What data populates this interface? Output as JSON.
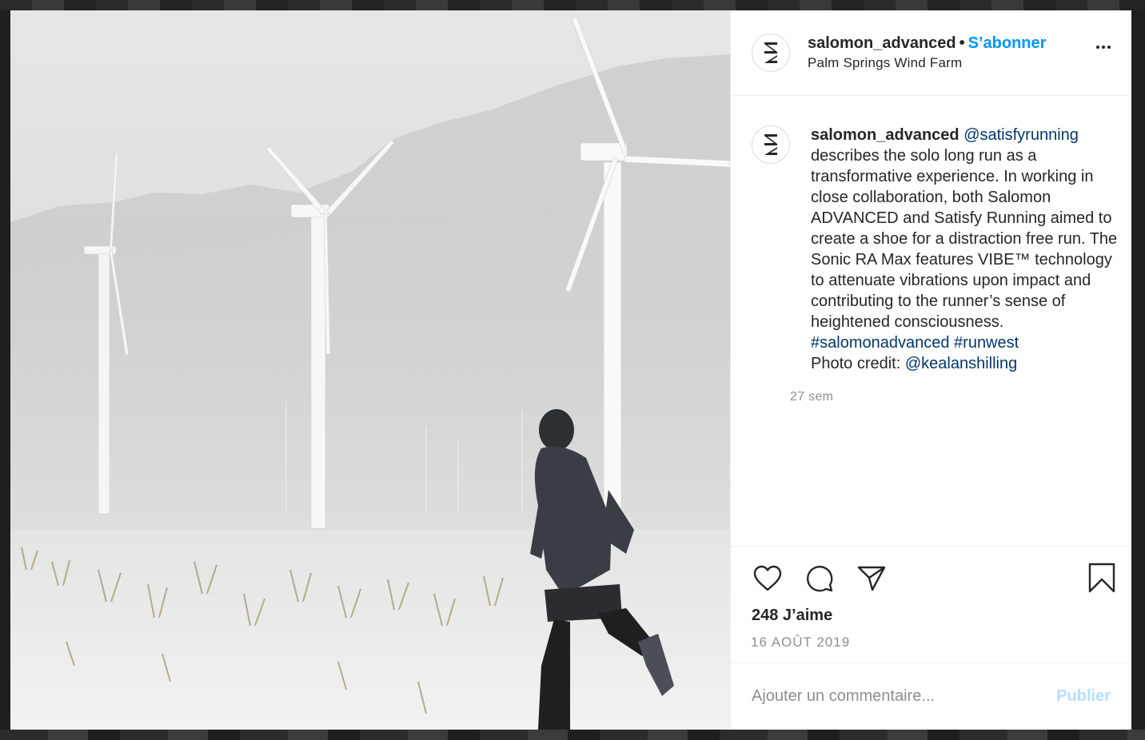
{
  "post": {
    "username": "salomon_advanced",
    "follow_label": "S’abonner",
    "location": "Palm Springs Wind Farm",
    "caption": {
      "username": "salomon_advanced",
      "mention_1": "@satisfyrunning",
      "text_1": "describes the solo long run as a transformative experience. In working in close collaboration, both Salomon ADVANCED and Satisfy Running aimed to create a shoe for a distraction free run. The Sonic RA Max features VIBE™ technology to attenuate vibrations upon impact and contributing to the runner’s sense of heightened consciousness.",
      "hashtag_1": "#salomonadvanced",
      "hashtag_2": "#runwest",
      "credit_label": "Photo credit:",
      "credit_mention": "@kealanshilling"
    },
    "time_ago": "27 sem",
    "likes": "248 J’aime",
    "date": "16 AOÛT 2019",
    "comment_placeholder": "Ajouter un commentaire...",
    "publish_label": "Publier"
  },
  "icons": {
    "like": "heart-icon",
    "comment": "comment-icon",
    "share": "paper-plane-icon",
    "save": "bookmark-icon",
    "more": "more-options-icon",
    "avatar": "salomon-logo"
  },
  "colors": {
    "follow": "#0095f6",
    "link": "#00376b",
    "muted": "#8e8e8e",
    "publish_disabled": "#b2dffc"
  }
}
